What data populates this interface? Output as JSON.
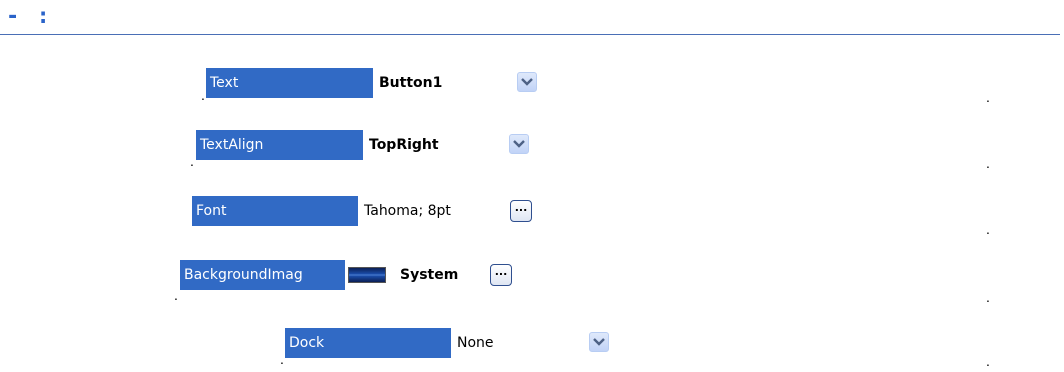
{
  "heading": "- :",
  "dot": ".",
  "properties": [
    {
      "name": "Text",
      "value": "Button1",
      "control": "dropdown"
    },
    {
      "name": "TextAlign",
      "value": "TopRight",
      "control": "dropdown"
    },
    {
      "name": "Font",
      "value": "Tahoma; 8pt",
      "control": "ellipsis"
    },
    {
      "name": "BackgroundImag",
      "value": "System",
      "control": "ellipsis",
      "thumbnail": "background-image-thumbnail"
    },
    {
      "name": "Dock",
      "value": "None",
      "control": "dropdown"
    }
  ],
  "ellipsis_label": "...",
  "colors": {
    "heading": "#2a63c9",
    "selected_name_bg": "#316ac5",
    "selected_name_fg": "#ffffff",
    "dropdown_arrow": "#4d6185"
  }
}
